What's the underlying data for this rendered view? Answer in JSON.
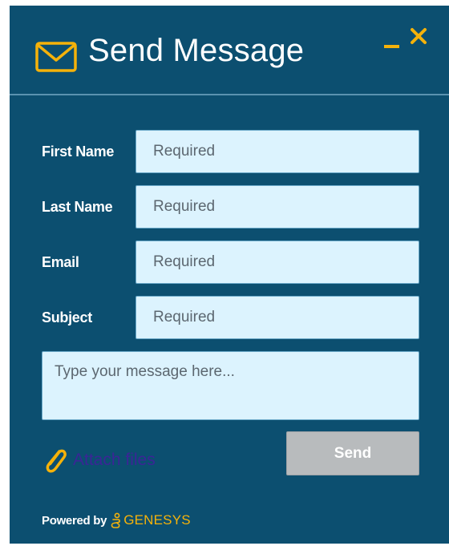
{
  "header": {
    "title": "Send Message",
    "icon": "envelope-icon",
    "minimize_icon": "minimize-icon",
    "close_icon": "close-icon",
    "accent_color": "#f5b20a"
  },
  "form": {
    "fields": [
      {
        "label": "First Name",
        "placeholder": "Required"
      },
      {
        "label": "Last Name",
        "placeholder": "Required"
      },
      {
        "label": "Email",
        "placeholder": "Required"
      },
      {
        "label": "Subject",
        "placeholder": "Required"
      }
    ],
    "message_placeholder": "Type your message here...",
    "attach_label": "Attach files",
    "attach_icon": "paperclip-icon",
    "send_label": "Send"
  },
  "footer": {
    "powered_by": "Powered by",
    "brand": "GENESYS"
  },
  "colors": {
    "panel_background": "#0c4f70",
    "input_background": "#dcf3fe",
    "send_disabled": "#b8bbbd",
    "attach_link": "#3b2596"
  }
}
